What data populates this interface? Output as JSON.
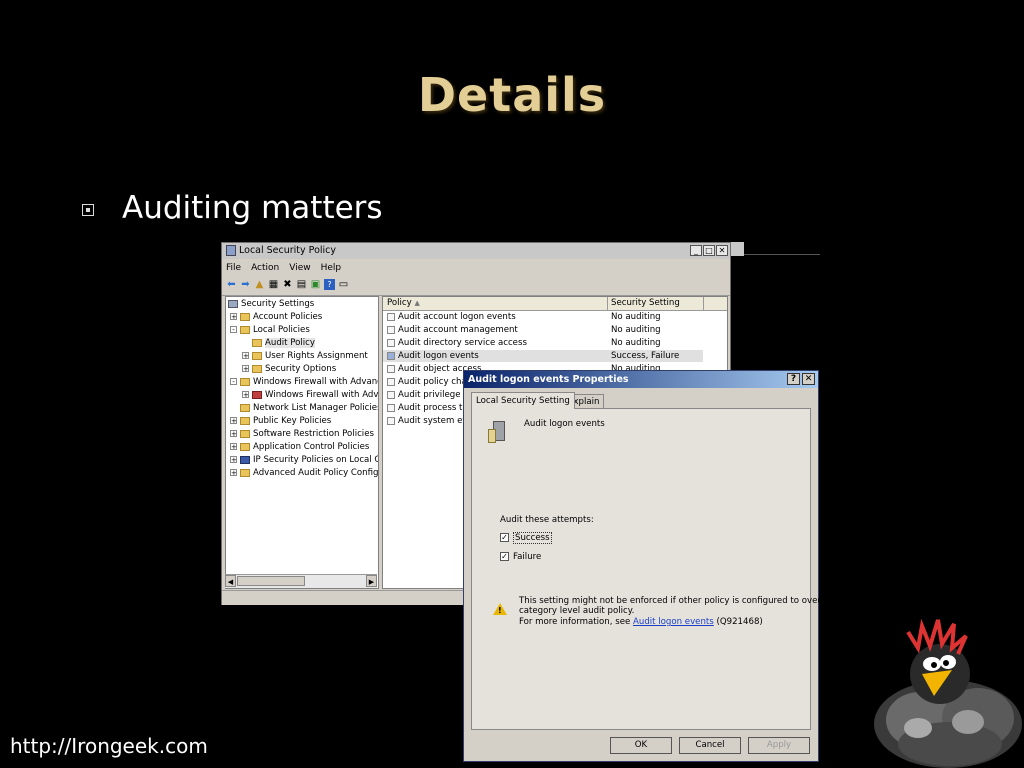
{
  "slide": {
    "title": "Details",
    "bullet": "Auditing matters",
    "footer_url": "http://Irongeek.com"
  },
  "main_window": {
    "title": "Local Security Policy",
    "menu": [
      "File",
      "Action",
      "View",
      "Help"
    ],
    "tree": [
      {
        "label": "Security Settings",
        "indent": 0,
        "expander": ""
      },
      {
        "label": "Account Policies",
        "indent": 1,
        "expander": "+"
      },
      {
        "label": "Local Policies",
        "indent": 1,
        "expander": "-"
      },
      {
        "label": "Audit Policy",
        "indent": 2,
        "expander": "",
        "selected": true
      },
      {
        "label": "User Rights Assignment",
        "indent": 2,
        "expander": "+"
      },
      {
        "label": "Security Options",
        "indent": 2,
        "expander": "+"
      },
      {
        "label": "Windows Firewall with Advanced",
        "indent": 1,
        "expander": "-"
      },
      {
        "label": "Windows Firewall with Advanc",
        "indent": 2,
        "expander": "+"
      },
      {
        "label": "Network List Manager Policies",
        "indent": 1,
        "expander": ""
      },
      {
        "label": "Public Key Policies",
        "indent": 1,
        "expander": "+"
      },
      {
        "label": "Software Restriction Policies",
        "indent": 1,
        "expander": "+"
      },
      {
        "label": "Application Control Policies",
        "indent": 1,
        "expander": "+"
      },
      {
        "label": "IP Security Policies on Local Com",
        "indent": 1,
        "expander": "+"
      },
      {
        "label": "Advanced Audit Policy Configura",
        "indent": 1,
        "expander": "+"
      }
    ],
    "columns": {
      "policy": "Policy",
      "setting": "Security Setting"
    },
    "rows": [
      {
        "policy": "Audit account logon events",
        "setting": "No auditing"
      },
      {
        "policy": "Audit account management",
        "setting": "No auditing"
      },
      {
        "policy": "Audit directory service access",
        "setting": "No auditing"
      },
      {
        "policy": "Audit logon events",
        "setting": "Success, Failure",
        "highlight": true
      },
      {
        "policy": "Audit object access",
        "setting": "No auditing"
      },
      {
        "policy": "Audit policy chang",
        "setting": ""
      },
      {
        "policy": "Audit privilege use",
        "setting": ""
      },
      {
        "policy": "Audit process track",
        "setting": ""
      },
      {
        "policy": "Audit system eve",
        "setting": ""
      }
    ]
  },
  "dialog": {
    "title": "Audit logon events Properties",
    "tabs": [
      "Local Security Setting",
      "Explain"
    ],
    "policy_name": "Audit logon events",
    "attempts_label": "Audit these attempts:",
    "success_label": "Success",
    "failure_label": "Failure",
    "success_checked": true,
    "failure_checked": true,
    "warning_line1": "This setting might not be enforced if other policy is configured to override",
    "warning_line2": "category level audit policy.",
    "info_prefix": "For more information, see",
    "info_link": "Audit logon events",
    "info_suffix": "(Q921468)",
    "ok_label": "OK",
    "cancel_label": "Cancel",
    "apply_label": "Apply"
  }
}
